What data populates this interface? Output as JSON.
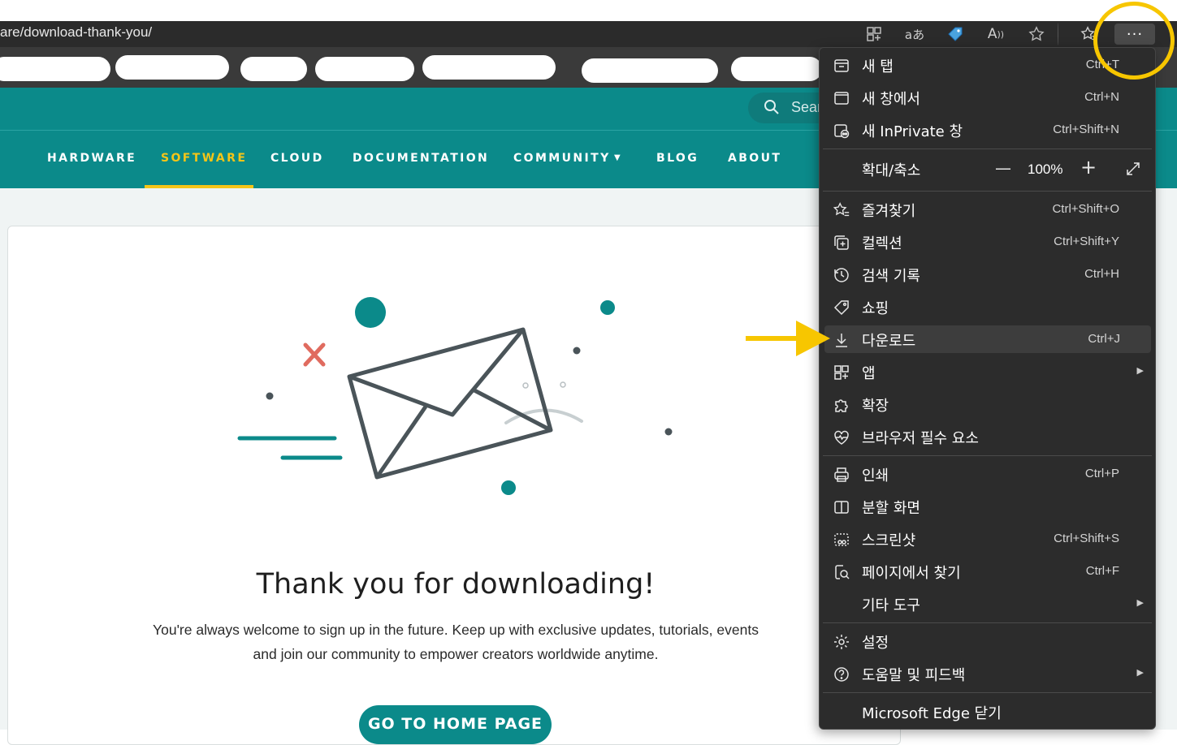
{
  "browser": {
    "url": "are/download-thank-you/",
    "toolbar_icons": [
      "app-grid-icon",
      "translate-icon",
      "shopping-tag-icon",
      "read-aloud-icon",
      "favorite-star-icon",
      "favorites-bar-icon"
    ],
    "more_button": "···"
  },
  "site": {
    "search_placeholder": "Sear",
    "nav": [
      {
        "label": "HARDWARE"
      },
      {
        "label": "SOFTWARE",
        "active": true
      },
      {
        "label": "CLOUD"
      },
      {
        "label": "DOCUMENTATION"
      },
      {
        "label": "COMMUNITY",
        "dropdown": true
      },
      {
        "label": "BLOG"
      },
      {
        "label": "ABOUT"
      }
    ],
    "nav_dropdown_glyph": "▼",
    "thanks_title": "Thank you for downloading!",
    "thanks_body": "You're always welcome to sign up in the future. Keep up with exclusive updates, tutorials, events and join our community to empower creators worldwide anytime.",
    "home_button": "GO TO HOME PAGE"
  },
  "menu": {
    "new_tab": {
      "label": "새 탭",
      "shortcut": "Ctrl+T"
    },
    "new_window": {
      "label": "새 창에서",
      "shortcut": "Ctrl+N"
    },
    "new_inprivate": {
      "label": "새 InPrivate 창",
      "shortcut": "Ctrl+Shift+N"
    },
    "zoom": {
      "label": "확대/축소",
      "value": "100%",
      "minus": "—",
      "plus": "+"
    },
    "favorites": {
      "label": "즐겨찾기",
      "shortcut": "Ctrl+Shift+O"
    },
    "collections": {
      "label": "컬렉션",
      "shortcut": "Ctrl+Shift+Y"
    },
    "history": {
      "label": "검색 기록",
      "shortcut": "Ctrl+H"
    },
    "shopping": {
      "label": "쇼핑"
    },
    "downloads": {
      "label": "다운로드",
      "shortcut": "Ctrl+J"
    },
    "apps": {
      "label": "앱"
    },
    "extensions": {
      "label": "확장"
    },
    "browser_essentials": {
      "label": "브라우저 필수 요소"
    },
    "print": {
      "label": "인쇄",
      "shortcut": "Ctrl+P"
    },
    "split_screen": {
      "label": "분할 화면"
    },
    "screenshot": {
      "label": "스크린샷",
      "shortcut": "Ctrl+Shift+S"
    },
    "find_on_page": {
      "label": "페이지에서 찾기",
      "shortcut": "Ctrl+F"
    },
    "more_tools": {
      "label": "기타 도구"
    },
    "settings": {
      "label": "설정"
    },
    "help_feedback": {
      "label": "도움말 및 피드백"
    },
    "close_edge": {
      "label": "Microsoft Edge 닫기"
    }
  },
  "colors": {
    "teal": "#0b8a8a",
    "active_nav": "#f5c518",
    "annotation": "#f7c600",
    "menu_bg": "#2c2c2c"
  }
}
